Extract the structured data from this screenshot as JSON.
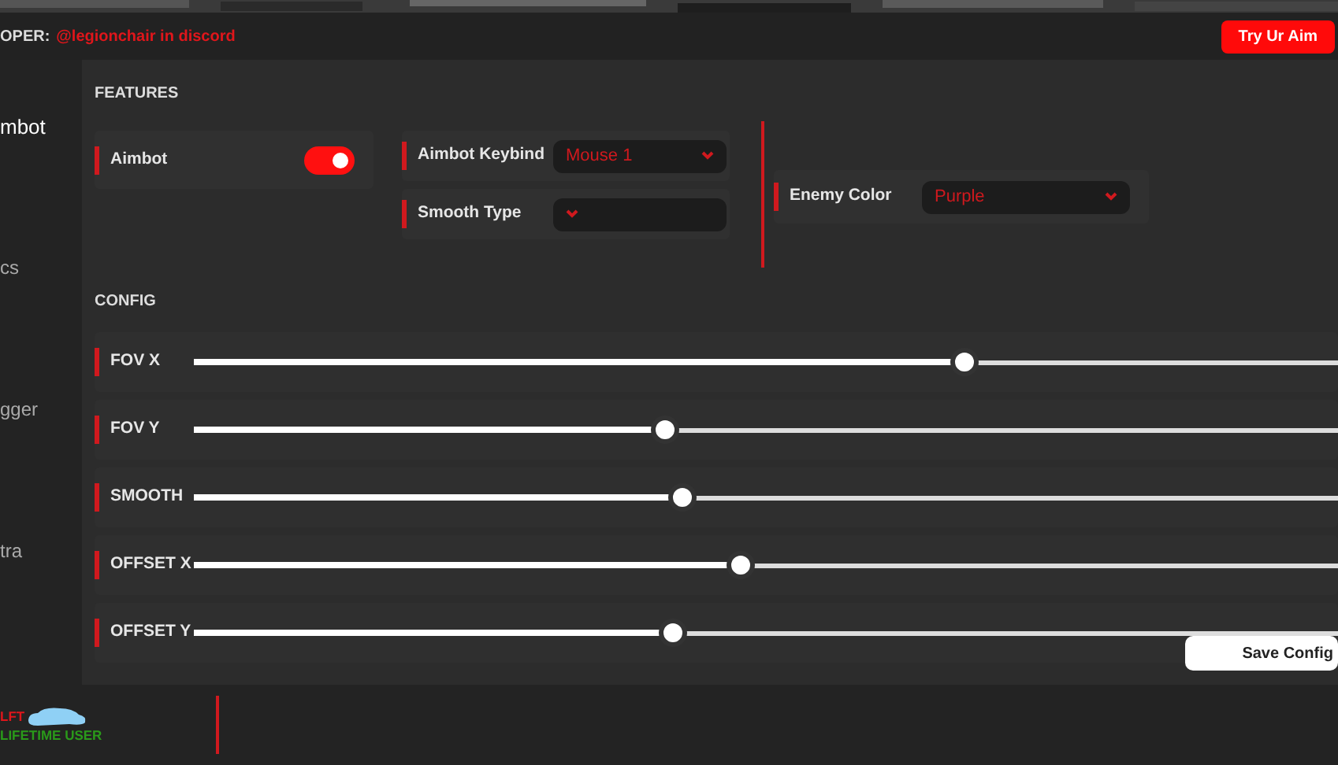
{
  "header": {
    "label": "OPER:",
    "contact": "@legionchair in discord",
    "button": "Try Ur Aim"
  },
  "sidebar": {
    "items": [
      {
        "label": "mbot",
        "selected": true
      },
      {
        "label": "cs",
        "selected": false
      },
      {
        "label": "gger",
        "selected": false
      },
      {
        "label": "tra",
        "selected": false
      }
    ]
  },
  "features": {
    "title": "FEATURES",
    "toggle": {
      "label": "Aimbot",
      "on": true
    },
    "dropdowns": [
      {
        "label": "Aimbot Keybind",
        "value": "Mouse 1"
      },
      {
        "label": "Smooth Type"
      }
    ],
    "enemy_color": {
      "label": "Enemy Color",
      "value": "Purple"
    }
  },
  "config": {
    "title": "CONFIG",
    "sliders": [
      {
        "label": "FOV X",
        "level": 0.673
      },
      {
        "label": "FOV Y",
        "level": 0.412
      },
      {
        "label": "SMOOTH",
        "level": 0.427
      },
      {
        "label": "OFFSET X",
        "level": 0.478
      },
      {
        "label": "OFFSET Y",
        "level": 0.419
      }
    ],
    "save_button": "Save Config"
  },
  "user": {
    "name": "LFT",
    "plan": "LIFETIME USER"
  }
}
